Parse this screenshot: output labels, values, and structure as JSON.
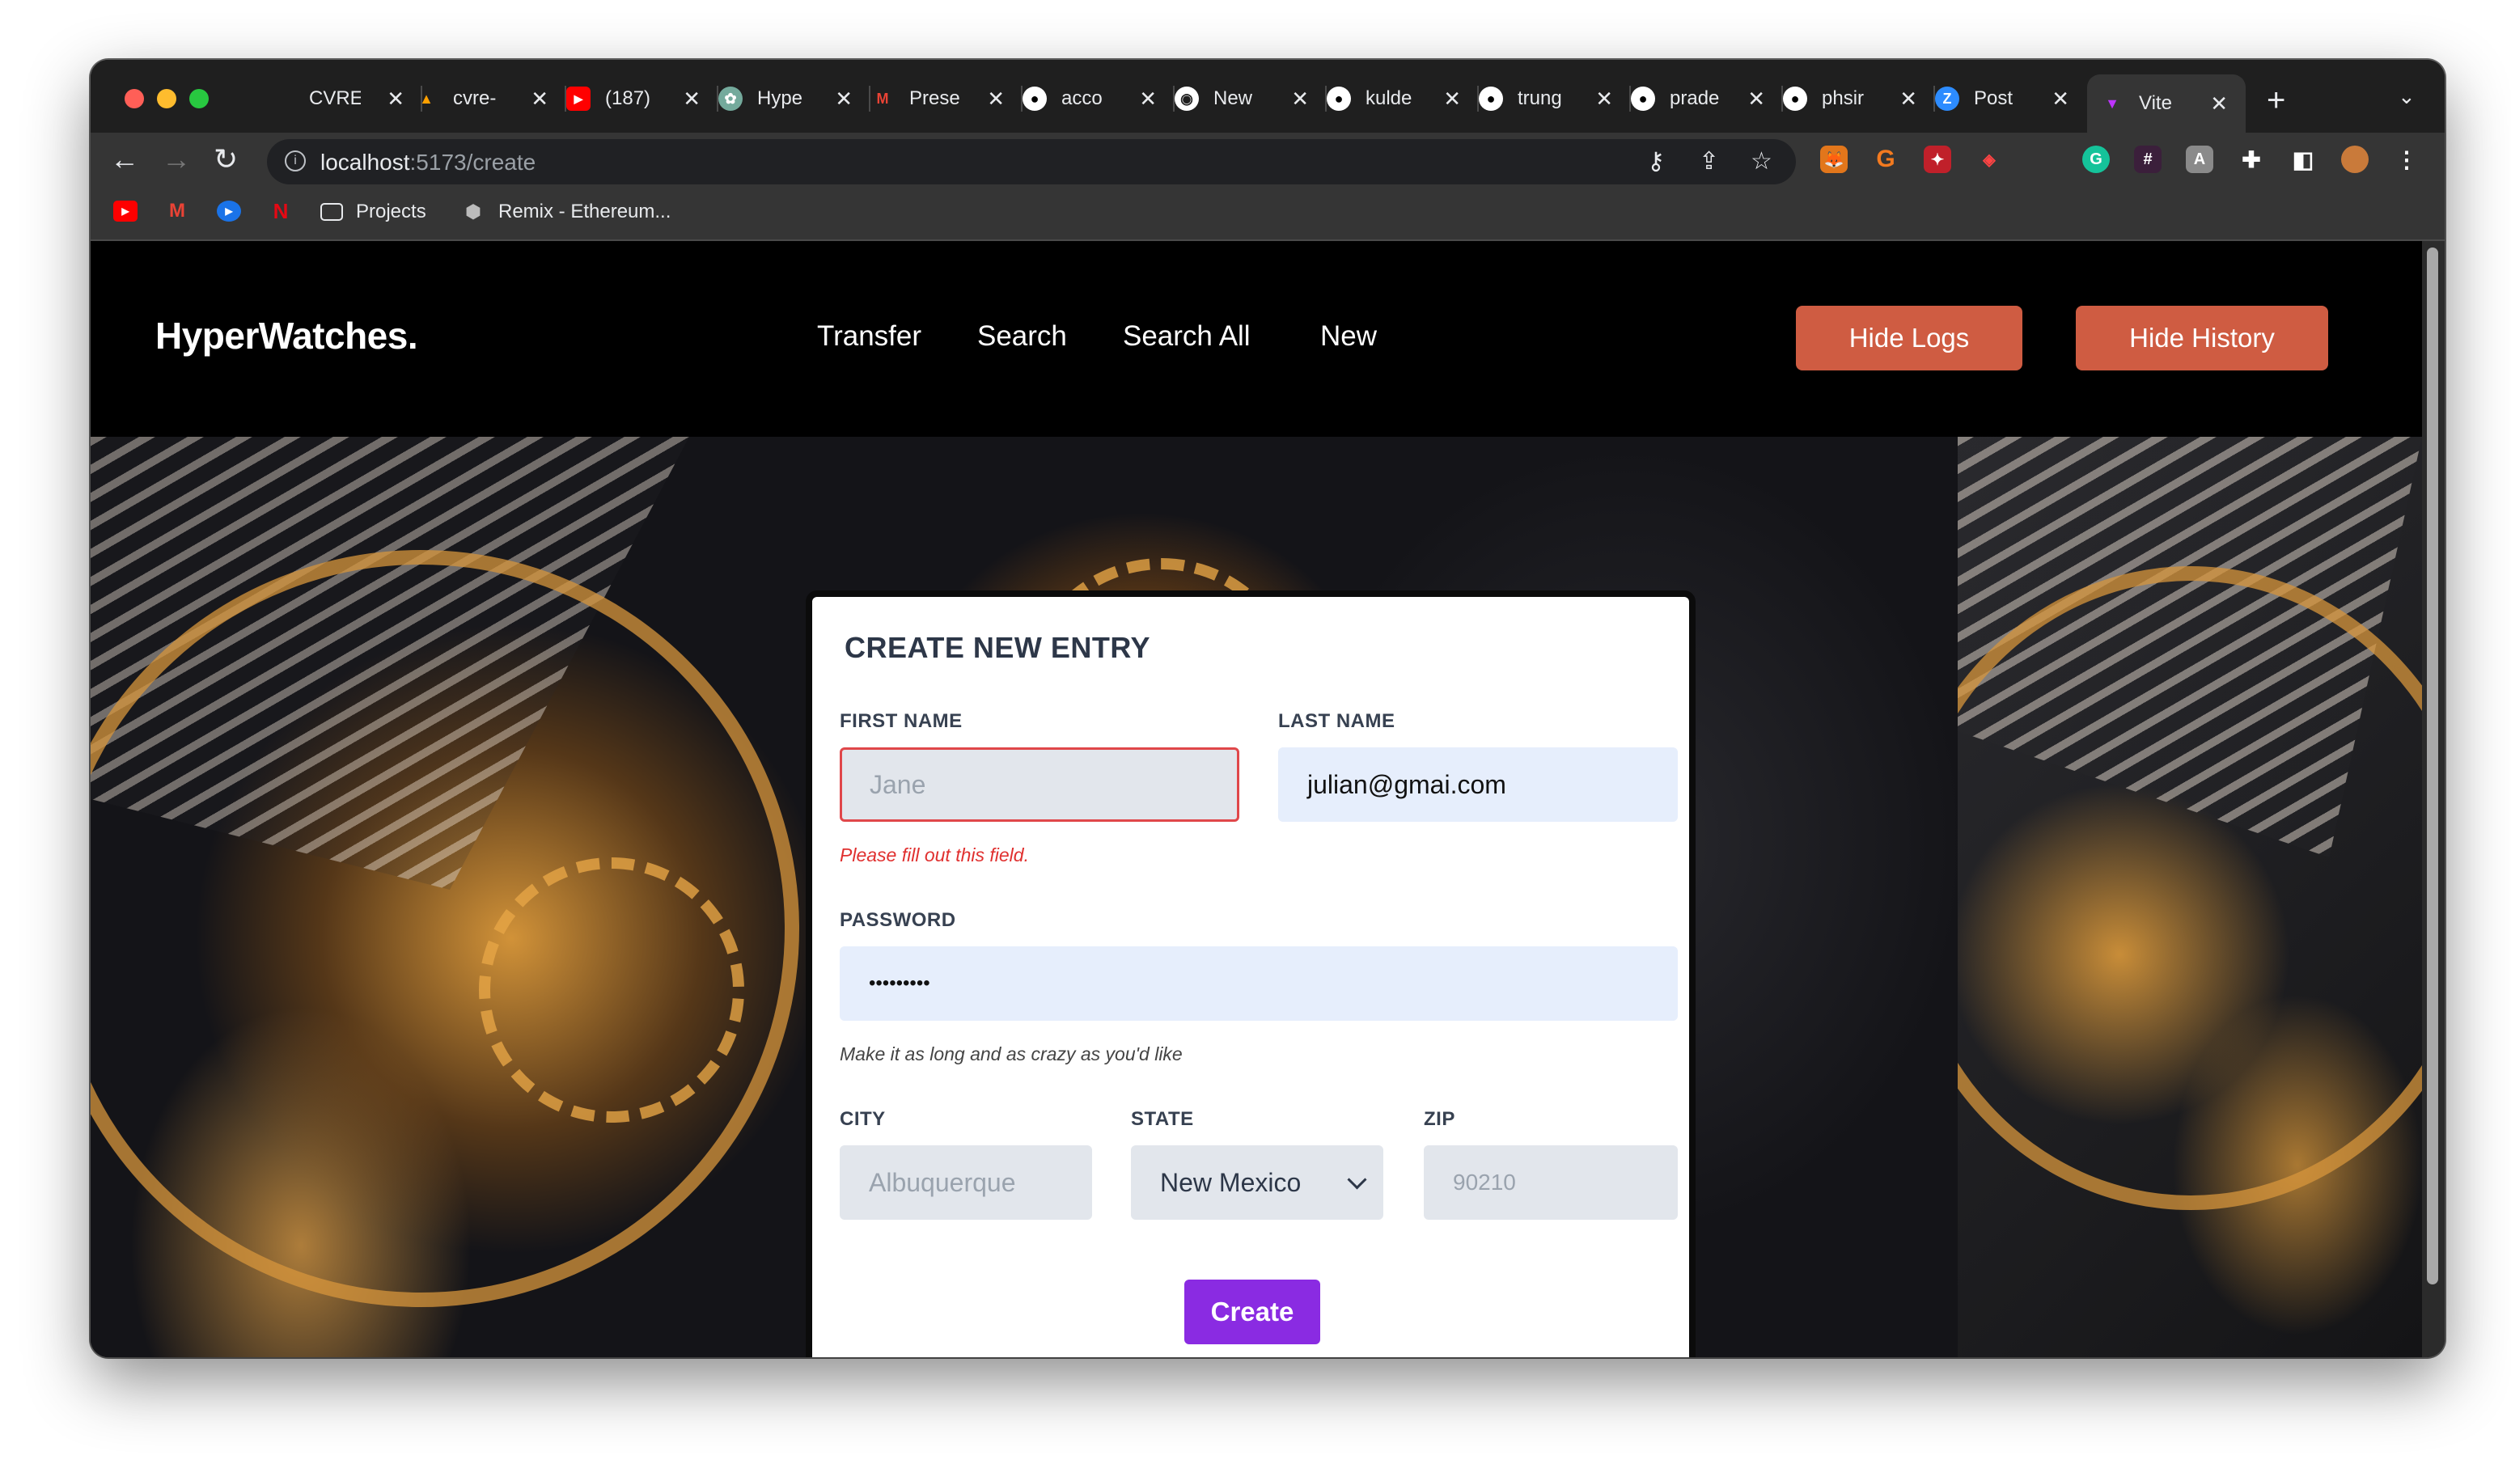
{
  "browser": {
    "tabs": [
      {
        "label": "CVRE",
        "icon": "cvre-icon",
        "color": "#1f1f1f"
      },
      {
        "label": "cvre-",
        "icon": "firebase-icon",
        "color": "#ffa000"
      },
      {
        "label": "(187)",
        "icon": "youtube-icon",
        "color": "#ff0000"
      },
      {
        "label": "Hype",
        "icon": "chatgpt-icon",
        "color": "#74aa9c"
      },
      {
        "label": "Prese",
        "icon": "gmail-icon",
        "color": "#ea4335"
      },
      {
        "label": "acco",
        "icon": "github-icon",
        "color": "#ffffff"
      },
      {
        "label": "New",
        "icon": "chrome-icon",
        "color": "#ffffff"
      },
      {
        "label": "kulde",
        "icon": "github-icon",
        "color": "#ffffff"
      },
      {
        "label": "trung",
        "icon": "github-icon",
        "color": "#ffffff"
      },
      {
        "label": "prade",
        "icon": "github-icon",
        "color": "#ffffff"
      },
      {
        "label": "phsir",
        "icon": "github-icon",
        "color": "#ffffff"
      },
      {
        "label": "Post",
        "icon": "zoom-icon",
        "color": "#2d8cff"
      },
      {
        "label": "Vite",
        "icon": "vite-icon",
        "color": "#bd34fe",
        "active": true
      }
    ],
    "url": {
      "host": "localhost",
      "path": ":5173/create"
    },
    "bookmarks": [
      {
        "label": "",
        "icon": "youtube-icon"
      },
      {
        "label": "",
        "icon": "gmail-icon"
      },
      {
        "label": "",
        "icon": "play-icon"
      },
      {
        "label": "",
        "icon": "netflix-icon"
      },
      {
        "label": "Projects",
        "icon": "folder-icon"
      },
      {
        "label": "Remix - Ethereum...",
        "icon": "remix-icon"
      }
    ]
  },
  "site": {
    "logo": "HyperWatches.",
    "nav": [
      "Transfer",
      "Search",
      "Search All",
      "New"
    ],
    "buttons": {
      "logs": "Hide Logs",
      "history": "Hide History"
    },
    "accent": "#cf5c42"
  },
  "form": {
    "title": "CREATE NEW ENTRY",
    "first_name": {
      "label": "FIRST NAME",
      "placeholder": "Jane",
      "value": "",
      "error": "Please fill out this field."
    },
    "last_name": {
      "label": "LAST NAME",
      "value": "julian@gmai.com"
    },
    "password": {
      "label": "PASSWORD",
      "value": "•••••••••",
      "hint": "Make it as long and as crazy as you'd like"
    },
    "city": {
      "label": "CITY",
      "placeholder": "Albuquerque"
    },
    "state": {
      "label": "STATE",
      "value": "New Mexico"
    },
    "zip": {
      "label": "ZIP",
      "placeholder": "90210"
    },
    "submit": "Create",
    "submit_color": "#8a2be2"
  }
}
